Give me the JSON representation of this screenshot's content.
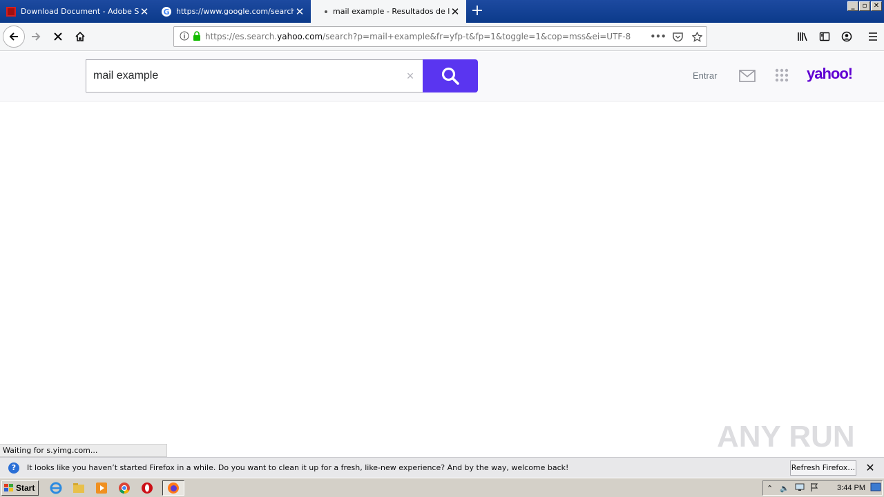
{
  "tabs": [
    {
      "title": "Download Document - Adobe Sign",
      "favicon": "adobe-sign-icon"
    },
    {
      "title": "https://www.google.com/search?q",
      "favicon": "google-icon"
    },
    {
      "title": "mail example - Resultados de la bú",
      "favicon": "loading-dot"
    }
  ],
  "urlbar": {
    "prefix": "https://es.search.",
    "domain": "yahoo.com",
    "suffix": "/search?p=mail+example&fr=yfp-t&fp=1&toggle=1&cop=mss&ei=UTF-8"
  },
  "search": {
    "query": "mail example",
    "clear_label": "×"
  },
  "header": {
    "signin_label": "Entrar",
    "logo_text": "yahoo!"
  },
  "status_text": "Waiting for s.yimg.com...",
  "watermark": "ANY RUN",
  "notification": {
    "message": "It looks like you haven’t started Firefox in a while. Do you want to clean it up for a fresh, like-new experience? And by the way, welcome back!",
    "button_label": "Refresh Firefox…"
  },
  "taskbar": {
    "start_label": "Start",
    "clock": "3:44 PM"
  },
  "colors": {
    "search_button": "#5a35f0",
    "yahoo_purple": "#6001d2",
    "titlebar": "#0b3a8a"
  }
}
